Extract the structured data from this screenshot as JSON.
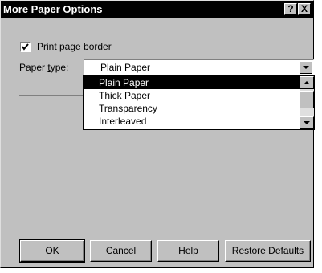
{
  "window": {
    "title": "More Paper Options",
    "help_glyph": "?",
    "close_glyph": "X"
  },
  "options": {
    "print_border_label": "Print page border",
    "print_border_checked": true,
    "paper_type_label": "Paper type:",
    "paper_type_selected": "Plain Paper"
  },
  "dropdown": {
    "items": [
      "Plain Paper",
      "Thick Paper",
      "Transparency",
      "Interleaved"
    ],
    "highlighted_index": 0
  },
  "buttons": {
    "ok": "OK",
    "cancel": "Cancel",
    "help": "Help",
    "restore_defaults": "Restore Defaults"
  }
}
